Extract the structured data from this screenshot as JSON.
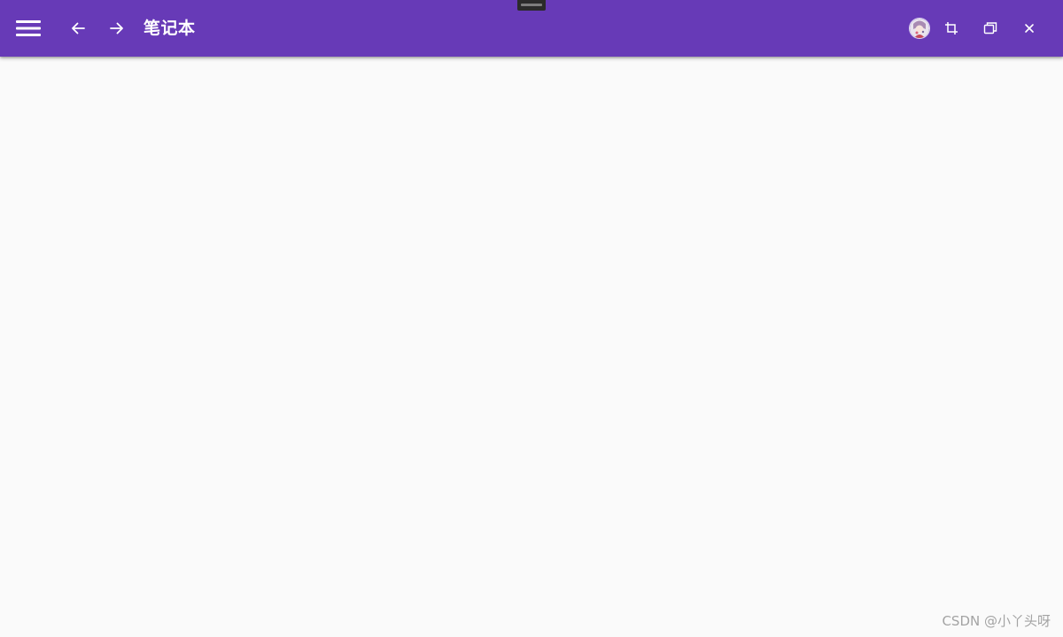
{
  "window": {
    "title": "笔记本"
  },
  "appbar": {
    "color": "#673ab7",
    "icons": {
      "menu": "hamburger-menu-icon",
      "back": "arrow-left-icon",
      "forward": "arrow-right-icon",
      "avatar": "user-avatar",
      "crop": "crop-icon",
      "restore": "restore-window-icon",
      "close": "close-icon"
    }
  },
  "watermark": {
    "text": "CSDN @小丫头呀"
  }
}
